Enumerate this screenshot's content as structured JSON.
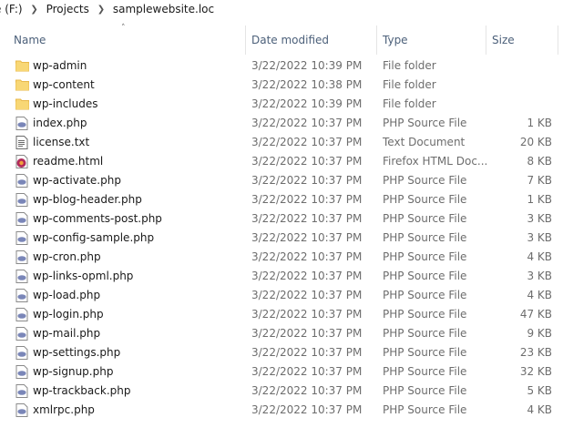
{
  "breadcrumb": {
    "drive": "e (F:)",
    "folder": "Projects",
    "current": "samplewebsite.loc"
  },
  "columns": {
    "name": "Name",
    "date": "Date modified",
    "type": "Type",
    "size": "Size"
  },
  "colors": {
    "folder": "#f8d775",
    "folder_dark": "#e8b84a",
    "php_icon": "#7a86b8",
    "text_icon": "#6a6a6a",
    "firefox_icon": "#b12a5b",
    "header_text": "#4c607a"
  },
  "files": [
    {
      "name": "wp-admin",
      "date": "3/22/2022 10:39 PM",
      "type": "File folder",
      "size": "",
      "icon": "folder-icon"
    },
    {
      "name": "wp-content",
      "date": "3/22/2022 10:38 PM",
      "type": "File folder",
      "size": "",
      "icon": "folder-icon"
    },
    {
      "name": "wp-includes",
      "date": "3/22/2022 10:39 PM",
      "type": "File folder",
      "size": "",
      "icon": "folder-icon"
    },
    {
      "name": "index.php",
      "date": "3/22/2022 10:37 PM",
      "type": "PHP Source File",
      "size": "1 KB",
      "icon": "php-file-icon"
    },
    {
      "name": "license.txt",
      "date": "3/22/2022 10:37 PM",
      "type": "Text Document",
      "size": "20 KB",
      "icon": "text-file-icon"
    },
    {
      "name": "readme.html",
      "date": "3/22/2022 10:37 PM",
      "type": "Firefox HTML Doc...",
      "size": "8 KB",
      "icon": "firefox-html-icon"
    },
    {
      "name": "wp-activate.php",
      "date": "3/22/2022 10:37 PM",
      "type": "PHP Source File",
      "size": "7 KB",
      "icon": "php-file-icon"
    },
    {
      "name": "wp-blog-header.php",
      "date": "3/22/2022 10:37 PM",
      "type": "PHP Source File",
      "size": "1 KB",
      "icon": "php-file-icon"
    },
    {
      "name": "wp-comments-post.php",
      "date": "3/22/2022 10:37 PM",
      "type": "PHP Source File",
      "size": "3 KB",
      "icon": "php-file-icon"
    },
    {
      "name": "wp-config-sample.php",
      "date": "3/22/2022 10:37 PM",
      "type": "PHP Source File",
      "size": "3 KB",
      "icon": "php-file-icon"
    },
    {
      "name": "wp-cron.php",
      "date": "3/22/2022 10:37 PM",
      "type": "PHP Source File",
      "size": "4 KB",
      "icon": "php-file-icon"
    },
    {
      "name": "wp-links-opml.php",
      "date": "3/22/2022 10:37 PM",
      "type": "PHP Source File",
      "size": "3 KB",
      "icon": "php-file-icon"
    },
    {
      "name": "wp-load.php",
      "date": "3/22/2022 10:37 PM",
      "type": "PHP Source File",
      "size": "4 KB",
      "icon": "php-file-icon"
    },
    {
      "name": "wp-login.php",
      "date": "3/22/2022 10:37 PM",
      "type": "PHP Source File",
      "size": "47 KB",
      "icon": "php-file-icon"
    },
    {
      "name": "wp-mail.php",
      "date": "3/22/2022 10:37 PM",
      "type": "PHP Source File",
      "size": "9 KB",
      "icon": "php-file-icon"
    },
    {
      "name": "wp-settings.php",
      "date": "3/22/2022 10:37 PM",
      "type": "PHP Source File",
      "size": "23 KB",
      "icon": "php-file-icon"
    },
    {
      "name": "wp-signup.php",
      "date": "3/22/2022 10:37 PM",
      "type": "PHP Source File",
      "size": "32 KB",
      "icon": "php-file-icon"
    },
    {
      "name": "wp-trackback.php",
      "date": "3/22/2022 10:37 PM",
      "type": "PHP Source File",
      "size": "5 KB",
      "icon": "php-file-icon"
    },
    {
      "name": "xmlrpc.php",
      "date": "3/22/2022 10:37 PM",
      "type": "PHP Source File",
      "size": "4 KB",
      "icon": "php-file-icon"
    }
  ]
}
